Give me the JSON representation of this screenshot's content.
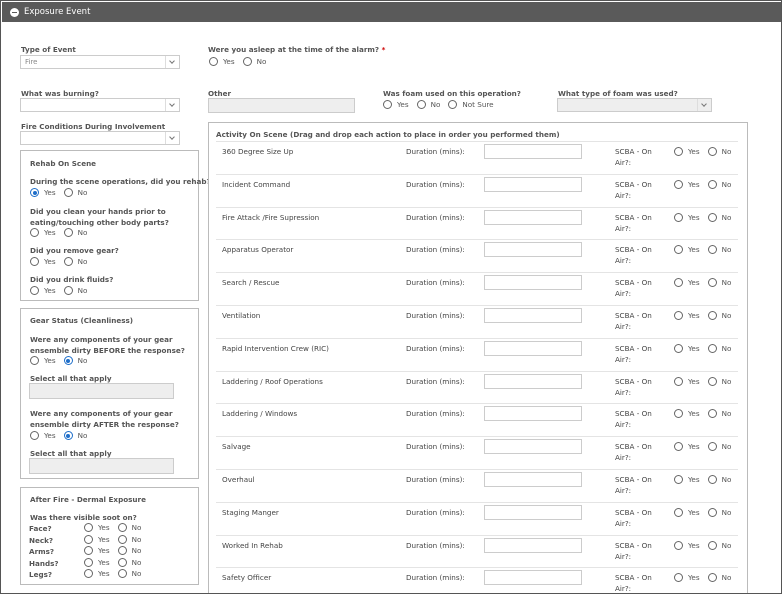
{
  "header": {
    "title": "Exposure Event"
  },
  "type_of_event": {
    "label": "Type of Event",
    "value": "Fire"
  },
  "asleep": {
    "label": "Were you asleep at the time of the alarm?",
    "required_mark": "*",
    "options": [
      "Yes",
      "No"
    ]
  },
  "what_burning": {
    "label": "What was burning?",
    "value": ""
  },
  "other": {
    "label": "Other",
    "value": ""
  },
  "foam_used": {
    "label": "Was foam used on this operation?",
    "options": [
      "Yes",
      "No",
      "Not Sure"
    ]
  },
  "foam_type": {
    "label": "What type of foam was used?",
    "value": ""
  },
  "fire_conditions": {
    "label": "Fire Conditions During Involvement",
    "value": ""
  },
  "rehab": {
    "title": "Rehab On Scene",
    "questions": [
      {
        "text": "During the scene operations, did you rehab?",
        "options": [
          "Yes",
          "No"
        ],
        "selected": "Yes"
      },
      {
        "text": "Did you clean your hands prior to eating/touching other body parts?",
        "options": [
          "Yes",
          "No"
        ],
        "selected": ""
      },
      {
        "text": "Did you remove gear?",
        "options": [
          "Yes",
          "No"
        ],
        "selected": ""
      },
      {
        "text": "Did you drink fluids?",
        "options": [
          "Yes",
          "No"
        ],
        "selected": ""
      }
    ]
  },
  "gear": {
    "title": "Gear Status (Cleanliness)",
    "before_q": "Were any components of your gear ensemble dirty BEFORE the response?",
    "before_options": [
      "Yes",
      "No"
    ],
    "before_selected": "No",
    "select_all_1": "Select all that apply",
    "after_q": "Were any components of your gear ensemble dirty AFTER the response?",
    "after_options": [
      "Yes",
      "No"
    ],
    "after_selected": "No",
    "select_all_2": "Select all that apply"
  },
  "dermal": {
    "title": "After Fire - Dermal Exposure",
    "question": "Was there visible soot on?",
    "rows": [
      {
        "label": "Face?",
        "yes": "Yes",
        "no": "No"
      },
      {
        "label": "Neck?",
        "yes": "Yes",
        "no": "No"
      },
      {
        "label": "Arms?",
        "yes": "Yes",
        "no": "No"
      },
      {
        "label": "Hands?",
        "yes": "Yes",
        "no": "No"
      },
      {
        "label": "Legs?",
        "yes": "Yes",
        "no": "No"
      }
    ]
  },
  "activity": {
    "title": "Activity On Scene (Drag and drop each action to place in order you performed them)",
    "duration_label": "Duration (mins):",
    "scba_label": "SCBA - On Air?:",
    "yes": "Yes",
    "no": "No",
    "items": [
      "360 Degree Size Up",
      "Incident Command",
      "Fire Attack /Fire Supression",
      "Apparatus Operator",
      "Search / Rescue",
      "Ventilation",
      "Rapid Intervention Crew (RIC)",
      "Laddering / Roof Operations",
      "Laddering / Windows",
      "Salvage",
      "Overhaul",
      "Staging Manger",
      "Worked In Rehab",
      "Safety Officer"
    ]
  }
}
